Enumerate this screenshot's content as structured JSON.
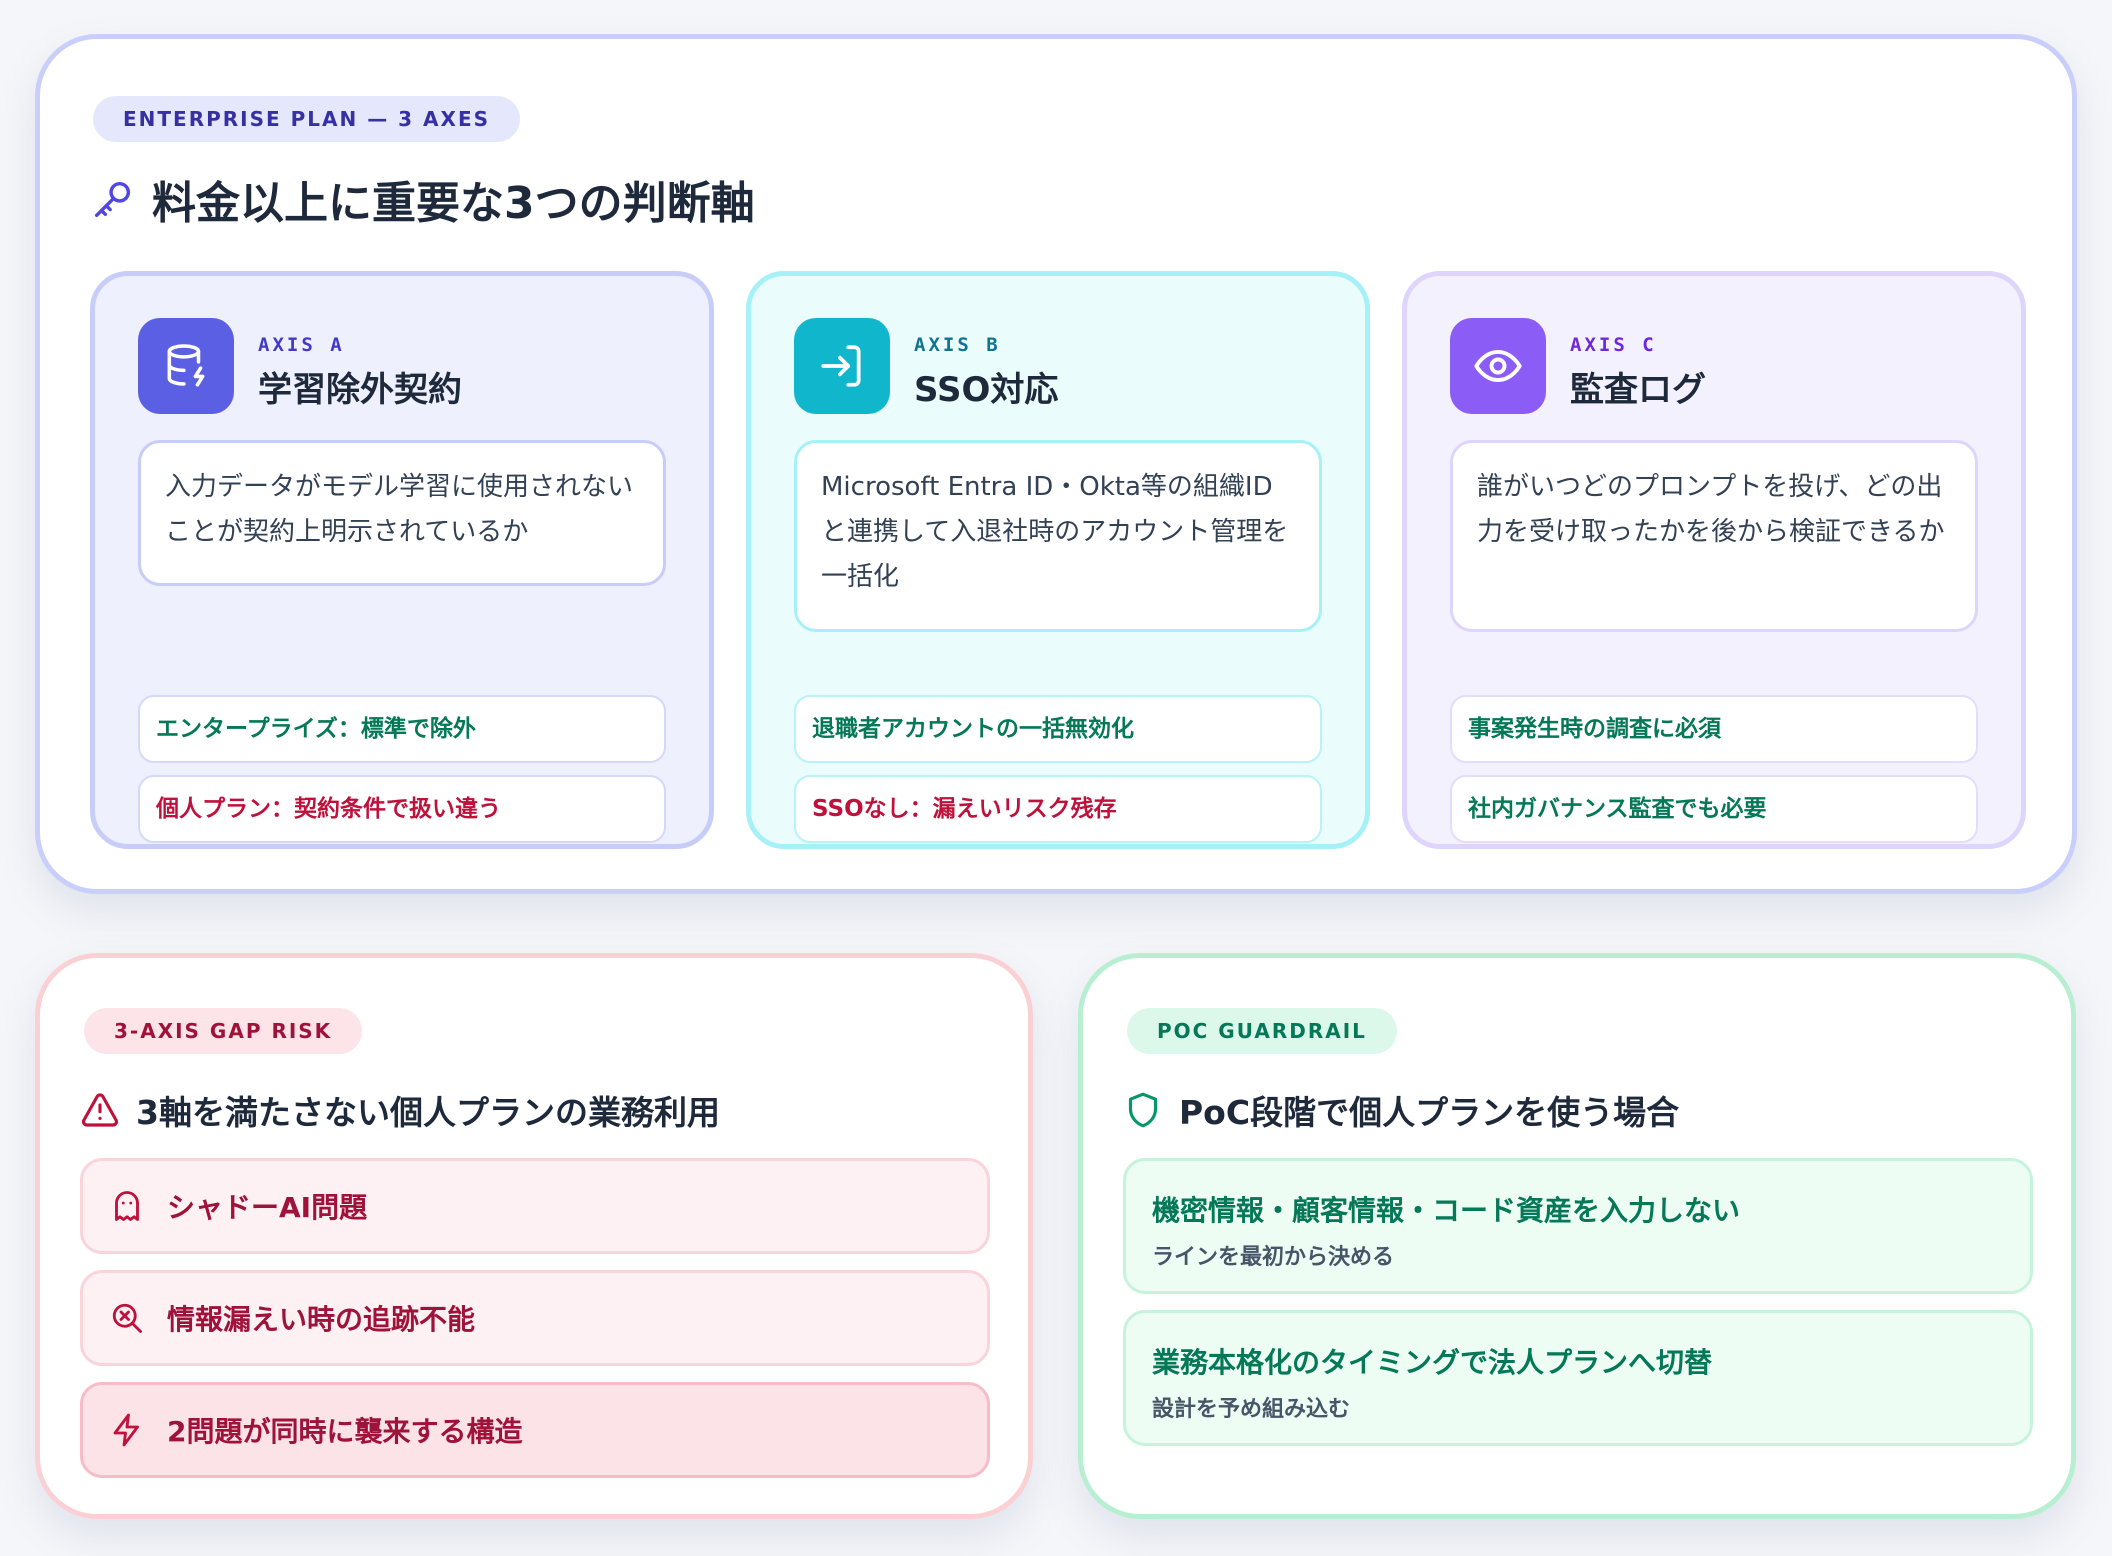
{
  "enterprise": {
    "badge": "ENTERPRISE PLAN — 3 AXES",
    "title": "料金以上に重要な3つの判断軸",
    "title_icon": "key-icon",
    "axes": [
      {
        "label": "AXIS A",
        "title": "学習除外契約",
        "icon": "database-icon",
        "color": "#5b5fe3",
        "description": "入力データがモデル学習に使用されないことが契約上明示されているか",
        "tags": [
          {
            "text": "エンタープライズ：標準で除外",
            "status": "good"
          },
          {
            "text": "個人プラン：契約条件で扱い違う",
            "status": "bad"
          }
        ]
      },
      {
        "label": "AXIS B",
        "title": "SSO対応",
        "icon": "login-icon",
        "color": "#10b7cc",
        "description": "Microsoft Entra ID・Okta等の組織IDと連携して入退社時のアカウント管理を一括化",
        "tags": [
          {
            "text": "退職者アカウントの一括無効化",
            "status": "good"
          },
          {
            "text": "SSOなし：漏えいリスク残存",
            "status": "bad"
          }
        ]
      },
      {
        "label": "AXIS C",
        "title": "監査ログ",
        "icon": "eye-icon",
        "color": "#8b5cf6",
        "description": "誰がいつどのプロンプトを投げ、どの出力を受け取ったかを後から検証できるか",
        "tags": [
          {
            "text": "事案発生時の調査に必須",
            "status": "good"
          },
          {
            "text": "社内ガバナンス監査でも必要",
            "status": "good"
          }
        ]
      }
    ]
  },
  "risk": {
    "badge": "3-AXIS GAP RISK",
    "title": "3軸を満たさない個人プランの業務利用",
    "title_icon": "warning-icon",
    "items": [
      {
        "text": "シャドーAI問題",
        "icon": "ghost-icon"
      },
      {
        "text": "情報漏えい時の追跡不能",
        "icon": "search-x-icon"
      },
      {
        "text": "2問題が同時に襲来する構造",
        "icon": "lightning-icon"
      }
    ]
  },
  "guardrail": {
    "badge": "POC GUARDRAIL",
    "title": "PoC段階で個人プランを使う場合",
    "title_icon": "shield-icon",
    "items": [
      {
        "title": "機密情報・顧客情報・コード資産を入力しない",
        "sub": "ラインを最初から決める"
      },
      {
        "title": "業務本格化のタイミングで法人プランへ切替",
        "sub": "設計を予め組み込む"
      }
    ]
  },
  "colors": {
    "indigo": "#5b5fe3",
    "cyan": "#10b7cc",
    "violet": "#8b5cf6",
    "good": "#047857",
    "bad": "#be123c"
  }
}
